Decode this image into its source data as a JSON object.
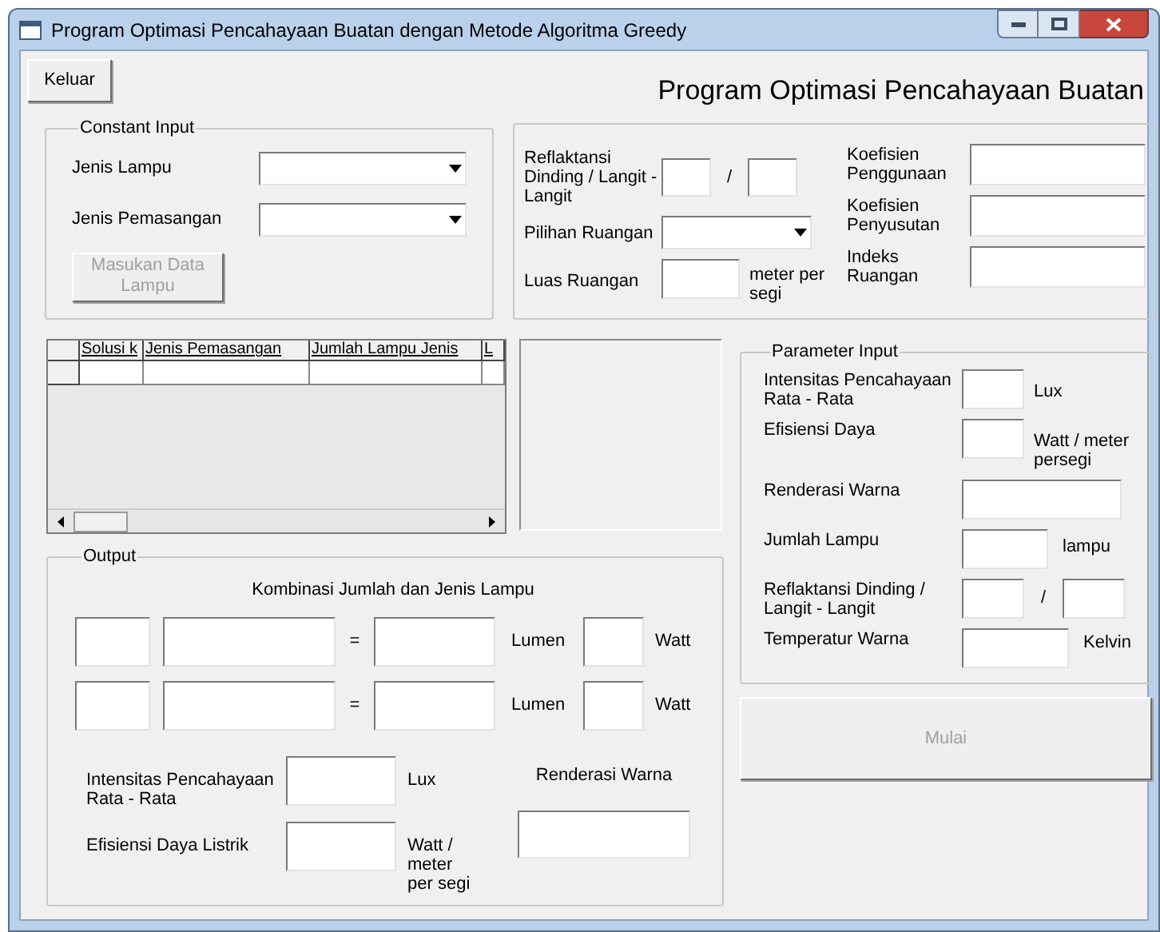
{
  "window": {
    "title": "Program Optimasi Pencahayaan Buatan dengan Metode Algoritma Greedy"
  },
  "exit_button": {
    "label": "Keluar",
    "disabled": false
  },
  "heading": "Program Optimasi Pencahayaan Buatan",
  "constant_input": {
    "title": "Constant Input",
    "fields": [
      {
        "label": "Jenis Lampu",
        "kind": "dropdown"
      },
      {
        "label": "Jenis Pemasangan",
        "kind": "dropdown"
      }
    ],
    "button": {
      "label": "Masukan Data Lampu",
      "disabled": true
    }
  },
  "room": {
    "left_fields": [
      {
        "label": "Reflaktansi Dinding / Langit - Langit",
        "kind": "ratio",
        "separator": "/"
      },
      {
        "label": "Pilihan Ruangan",
        "kind": "dropdown"
      },
      {
        "label": "Luas Ruangan",
        "kind": "text",
        "unit": "meter per segi"
      }
    ],
    "right_fields": [
      {
        "label": "Koefisien Penggunaan",
        "kind": "text"
      },
      {
        "label": "Koefisien Penyusutan",
        "kind": "text"
      },
      {
        "label": "Indeks Ruangan",
        "kind": "text"
      }
    ]
  },
  "solution_table": {
    "columns": [
      "Solusi k",
      "Jenis Pemasangan",
      "Jumlah Lampu Jenis",
      "L"
    ]
  },
  "parameter_input": {
    "title": "Parameter Input",
    "fields": [
      {
        "label": "Intensitas Pencahayaan Rata - Rata",
        "kind": "short",
        "unit": "Lux"
      },
      {
        "label": "Efisiensi Daya",
        "kind": "short",
        "unit": "Watt / meter persegi"
      },
      {
        "label": "Renderasi Warna",
        "kind": "wide"
      },
      {
        "label": "Jumlah Lampu",
        "kind": "medium",
        "unit": "lampu"
      },
      {
        "label": "Reflaktansi Dinding / Langit - Langit",
        "kind": "ratio",
        "separator": "/"
      },
      {
        "label": "Temperatur Warna",
        "kind": "long",
        "unit": "Kelvin"
      }
    ]
  },
  "start_button": {
    "label": "Mulai",
    "disabled": true
  },
  "output": {
    "title": "Output",
    "subtitle": "Kombinasi Jumlah dan Jenis Lampu",
    "rows": [
      {
        "operator": "=",
        "unit_1": "Lumen",
        "unit_2": "Watt"
      },
      {
        "operator": "=",
        "unit_1": "Lumen",
        "unit_2": "Watt"
      }
    ],
    "fields": [
      {
        "label": "Intensitas Pencahayaan Rata - Rata",
        "unit": "Lux"
      },
      {
        "label": "Efisiensi Daya Listrik",
        "unit": "Watt / meter per segi"
      }
    ],
    "color_rendering": {
      "label": "Renderasi Warna"
    }
  }
}
